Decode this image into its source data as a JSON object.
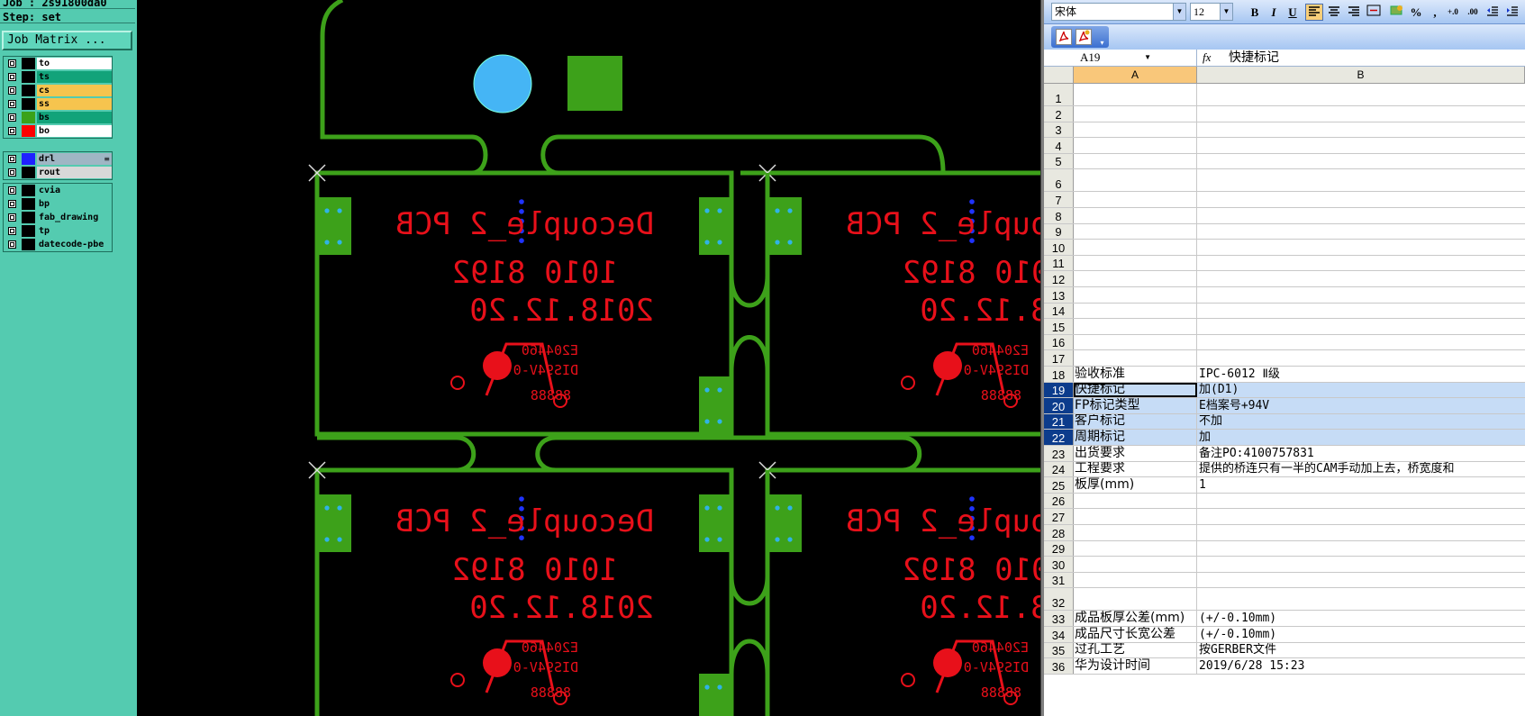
{
  "cam": {
    "job_label": "Job : 2s91800da0",
    "step_label": "Step: set",
    "job_matrix_button": "Job Matrix ...",
    "layer_groups": [
      [
        {
          "name": "to",
          "color": "#000000",
          "bg": "#ffffff"
        },
        {
          "name": "ts",
          "color": "#000000",
          "bg": "#12a37a"
        },
        {
          "name": "cs",
          "color": "#000000",
          "bg": "#f6c44e"
        },
        {
          "name": "ss",
          "color": "#000000",
          "bg": "#f6c44e"
        },
        {
          "name": "bs",
          "color": "#3aa21a",
          "bg": "#12a37a"
        },
        {
          "name": "bo",
          "color": "#ff0000",
          "bg": "#ffffff"
        }
      ],
      [
        {
          "name": "drl",
          "color": "#1f22ff",
          "bg": "#9fb6c4",
          "extra": "≡"
        },
        {
          "name": "rout",
          "color": "#000000",
          "bg": "#d8d8d8"
        }
      ],
      [
        {
          "name": "cvia",
          "color": "#000000",
          "bg": "#54cbb0"
        },
        {
          "name": "bp",
          "color": "#000000",
          "bg": "#54cbb0"
        },
        {
          "name": "fab_drawing",
          "color": "#000000",
          "bg": "#54cbb0"
        },
        {
          "name": "tp",
          "color": "#000000",
          "bg": "#54cbb0"
        },
        {
          "name": "datecode-pbe",
          "color": "#000000",
          "bg": "#54cbb0"
        }
      ]
    ]
  },
  "pcb": {
    "board_title": "Decouple_2 PCB",
    "board_code": "1010 8192",
    "board_date": "2018.12.20",
    "ul_code": "E204460",
    "ul_rating": "DIS94V-0",
    "ul_date": "88888",
    "colors": {
      "outline": "#3da11a",
      "pad": "#3da11a",
      "text": "#e8101a",
      "hole": "#2fb3e6",
      "fiducial": "#45b5f5",
      "drill": "#1f33ff"
    }
  },
  "excel": {
    "font_name": "宋体",
    "font_size": "12",
    "bold": "B",
    "italic": "I",
    "underline": "U",
    "percent": "%",
    "comma": ",",
    "inc_decimal": "+.0",
    "dec_decimal": ".00",
    "name_box": "A19",
    "fx": "fx",
    "formula_value": "快捷标记",
    "col_a": "A",
    "col_b": "B",
    "rows": [
      {
        "n": "1",
        "a": "",
        "b": ""
      },
      {
        "n": "2",
        "a": "",
        "b": ""
      },
      {
        "n": "3",
        "a": "",
        "b": ""
      },
      {
        "n": "4",
        "a": "",
        "b": ""
      },
      {
        "n": "5",
        "a": "",
        "b": ""
      },
      {
        "n": "6",
        "a": "",
        "b": ""
      },
      {
        "n": "7",
        "a": "",
        "b": ""
      },
      {
        "n": "8",
        "a": "",
        "b": ""
      },
      {
        "n": "9",
        "a": "",
        "b": ""
      },
      {
        "n": "10",
        "a": "",
        "b": ""
      },
      {
        "n": "11",
        "a": "",
        "b": ""
      },
      {
        "n": "12",
        "a": "",
        "b": ""
      },
      {
        "n": "13",
        "a": "",
        "b": ""
      },
      {
        "n": "14",
        "a": "",
        "b": ""
      },
      {
        "n": "15",
        "a": "",
        "b": ""
      },
      {
        "n": "16",
        "a": "",
        "b": ""
      },
      {
        "n": "17",
        "a": "",
        "b": ""
      },
      {
        "n": "18",
        "a": "验收标准",
        "b": "IPC-6012 Ⅱ级"
      },
      {
        "n": "19",
        "a": "快捷标记",
        "b": "加(D1)",
        "sel": true,
        "active": true
      },
      {
        "n": "20",
        "a": "FP标记类型",
        "b": "E档案号+94V",
        "sel": true
      },
      {
        "n": "21",
        "a": "客户标记",
        "b": "不加",
        "sel": true
      },
      {
        "n": "22",
        "a": "周期标记",
        "b": "加",
        "sel": true
      },
      {
        "n": "23",
        "a": "出货要求",
        "b": "备注PO:4100757831"
      },
      {
        "n": "24",
        "a": "工程要求",
        "b": "提供的桥连只有一半的CAM手动加上去，桥宽度和"
      },
      {
        "n": "25",
        "a": "板厚(mm)",
        "b": "1"
      },
      {
        "n": "26",
        "a": "",
        "b": ""
      },
      {
        "n": "27",
        "a": "",
        "b": ""
      },
      {
        "n": "28",
        "a": "",
        "b": ""
      },
      {
        "n": "29",
        "a": "",
        "b": ""
      },
      {
        "n": "30",
        "a": "",
        "b": ""
      },
      {
        "n": "31",
        "a": "",
        "b": ""
      },
      {
        "n": "32",
        "a": "",
        "b": ""
      },
      {
        "n": "33",
        "a": "成品板厚公差(mm)",
        "b": "(+/-0.10mm)"
      },
      {
        "n": "34",
        "a": "成品尺寸长宽公差",
        "b": "(+/-0.10mm)"
      },
      {
        "n": "35",
        "a": "过孔工艺",
        "b": "按GERBER文件"
      },
      {
        "n": "36",
        "a": "华为设计时间",
        "b": "2019/6/28 15:23"
      }
    ]
  }
}
